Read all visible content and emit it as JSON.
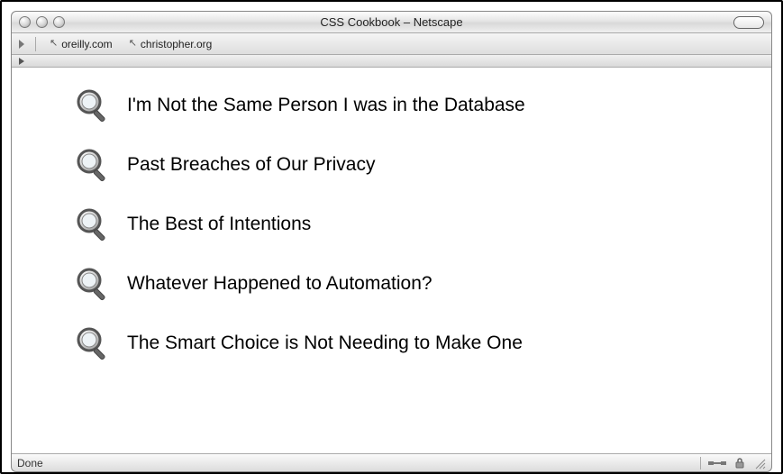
{
  "window": {
    "title": "CSS Cookbook – Netscape"
  },
  "bookmarks": {
    "items": [
      {
        "label": "oreilly.com"
      },
      {
        "label": "christopher.org"
      }
    ]
  },
  "content": {
    "items": [
      {
        "text": "I'm Not the Same Person I was in the Database"
      },
      {
        "text": "Past Breaches of Our Privacy"
      },
      {
        "text": "The Best of Intentions"
      },
      {
        "text": "Whatever Happened to Automation?"
      },
      {
        "text": "The Smart Choice is Not Needing to Make One"
      }
    ]
  },
  "status": {
    "text": "Done"
  }
}
